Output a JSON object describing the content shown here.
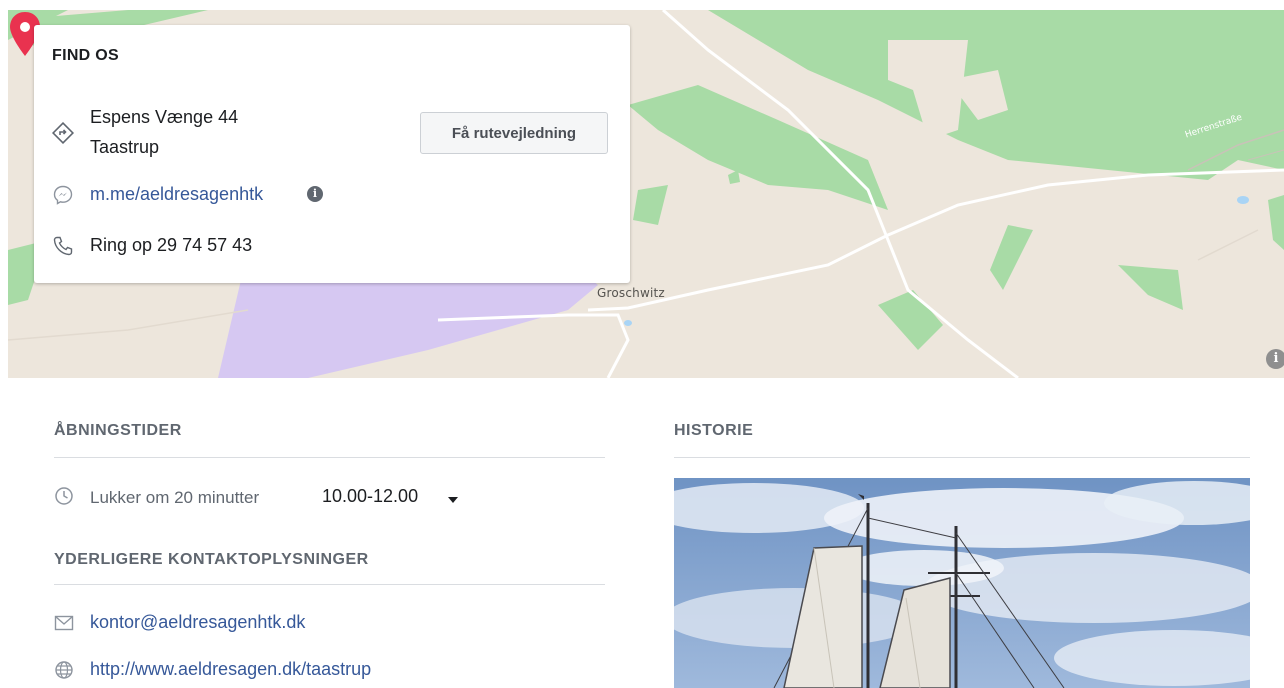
{
  "map": {
    "town_label": "Groschwitz",
    "street_label": "Herrenstraße",
    "info_glyph": "i",
    "colors": {
      "land": "#ede6dc",
      "forest": "#a8dba6",
      "special_area": "#d6c8f2",
      "pin": "#e9324f"
    }
  },
  "find_us": {
    "title": "FIND OS",
    "address_line1": "Espens Vænge 44",
    "address_line2": "Taastrup",
    "directions_button": "Få rutevejledning",
    "messenger_link": "m.me/aeldresagenhtk",
    "info_glyph": "i",
    "phone": "Ring op 29 74 57 43"
  },
  "opening_hours": {
    "heading": "ÅBNINGSTIDER",
    "status": "Lukker om 20 minutter",
    "hours": "10.00-12.00"
  },
  "more_contact": {
    "heading": "YDERLIGERE KONTAKTOPLYSNINGER",
    "email": "kontor@aeldresagenhtk.dk",
    "website": "http://www.aeldresagen.dk/taastrup"
  },
  "history": {
    "heading": "HISTORIE"
  },
  "icons": {
    "directions": "directions-icon",
    "messenger": "messenger-icon",
    "phone": "phone-icon",
    "clock": "clock-icon",
    "email": "envelope-icon",
    "website": "globe-icon"
  }
}
